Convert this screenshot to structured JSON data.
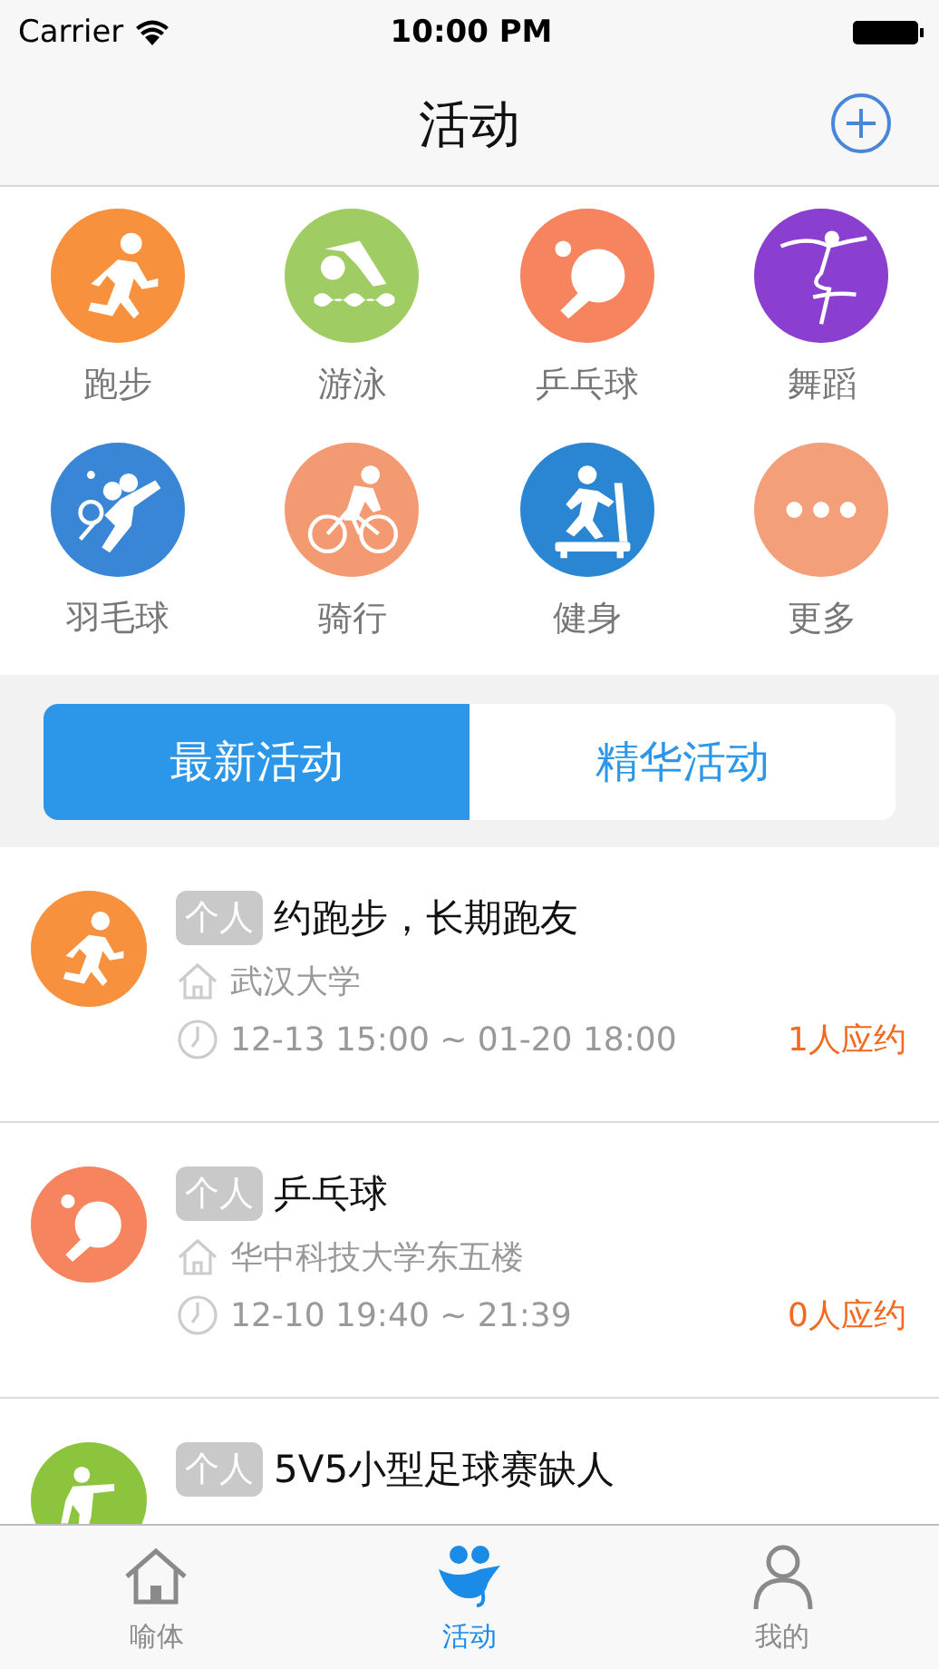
{
  "status_bar": {
    "carrier": "Carrier",
    "time": "10:00 PM"
  },
  "nav": {
    "title": "活动"
  },
  "categories": [
    {
      "label": "跑步",
      "kind": "run",
      "color": "#f7913d"
    },
    {
      "label": "游泳",
      "kind": "swim",
      "color": "#9fcc63"
    },
    {
      "label": "乒乓球",
      "kind": "pingpong",
      "color": "#f5845f"
    },
    {
      "label": "舞蹈",
      "kind": "dance",
      "color": "#8b3fd0"
    },
    {
      "label": "羽毛球",
      "kind": "badminton",
      "color": "#3a86d6"
    },
    {
      "label": "骑行",
      "kind": "cycle",
      "color": "#f39a72"
    },
    {
      "label": "健身",
      "kind": "fitness",
      "color": "#2a86d3"
    },
    {
      "label": "更多",
      "kind": "more",
      "color": "#f39f7a"
    }
  ],
  "segments": [
    {
      "label": "最新活动",
      "selected": true
    },
    {
      "label": "精华活动",
      "selected": false
    }
  ],
  "activities": [
    {
      "kind": "run",
      "color": "#f7913d",
      "tag": "个人",
      "title": "约跑步，长期跑友",
      "location": "武汉大学",
      "time": "12-13 15:00 ~ 01-20 18:00",
      "signups": "1人应约"
    },
    {
      "kind": "pingpong",
      "color": "#f5845f",
      "tag": "个人",
      "title": "乒乓球",
      "location": "华中科技大学东五楼",
      "time": "12-10 19:40 ~ 21:39",
      "signups": "0人应约"
    },
    {
      "kind": "soccer",
      "color": "#8cc43d",
      "tag": "个人",
      "title": "5V5小型足球赛缺人"
    }
  ],
  "tab_bar": [
    {
      "label": "喻体",
      "kind": "home",
      "selected": false
    },
    {
      "label": "活动",
      "kind": "people",
      "selected": true
    },
    {
      "label": "我的",
      "kind": "person",
      "selected": false
    }
  ]
}
